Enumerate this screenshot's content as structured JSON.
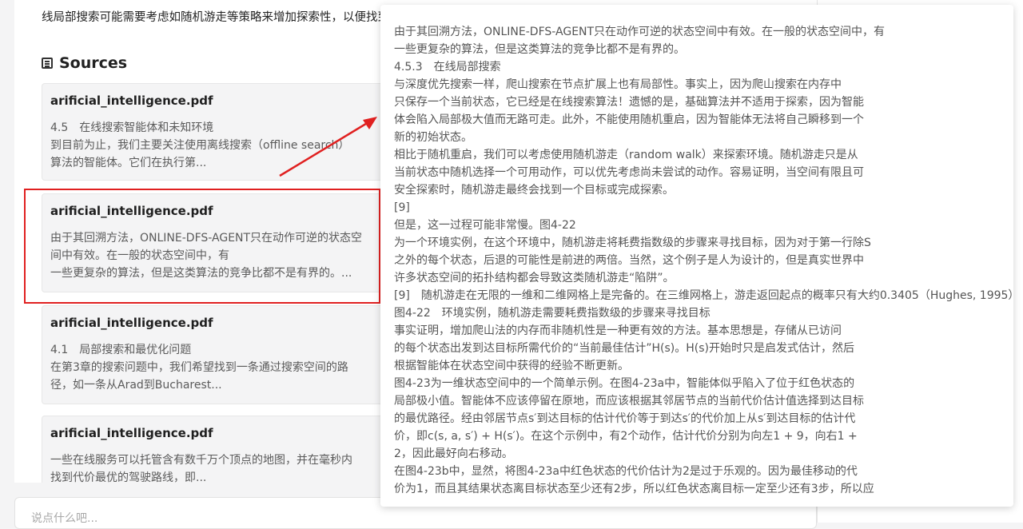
{
  "answer": {
    "partial_line": "线局部搜索可能需要考虑如随机游走等策略来增加探索性，以便找到更好的解。"
  },
  "sources": {
    "title": "Sources",
    "icon": "book-icon",
    "cards": [
      {
        "filename": "arificial_intelligence.pdf",
        "excerpt": "4.5　在线搜索智能体和未知环境\n到目前为止，我们主要关注使用离线搜索（offline search）\n算法的智能体。它们在执行第..."
      },
      {
        "filename": "arificial_intelligence.pdf",
        "excerpt": "由于其回溯方法，ONLINE-DFS-AGENT只在动作可逆的状态空\n间中有效。在一般的状态空间中，有\n一些更复杂的算法，但是这类算法的竞争比都不是有界的。..."
      },
      {
        "filename": "arificial_intelligence.pdf",
        "excerpt": "4.1　局部搜索和最优化问题\n在第3章的搜索问题中，我们希望找到一条通过搜索空间的路\n径，如一条从Arad到Bucharest..."
      },
      {
        "filename": "arificial_intelligence.pdf",
        "excerpt": "一些在线服务可以托管含有数千万个顶点的地图，并在毫秒内\n找到代价最优的驾驶路线，即..."
      }
    ]
  },
  "input": {
    "placeholder": "说点什么吧..."
  },
  "popover": {
    "lines": [
      "由于其回溯方法，ONLINE-DFS-AGENT只在动作可逆的状态空间中有效。在一般的状态空间中，有",
      "一些更复杂的算法，但是这类算法的竞争比都不是有界的。",
      "4.5.3　在线局部搜索",
      "与深度优先搜索一样，爬山搜索在节点扩展上也有局部性。事实上，因为爬山搜索在内存中",
      "只保存一个当前状态，它已经是在线搜索算法！遗憾的是，基础算法并不适用于探索，因为智能",
      "体会陷入局部极大值而无路可走。此外，不能使用随机重启，因为智能体无法将自己瞬移到一个",
      "新的初始状态。",
      "相比于随机重启，我们可以考虑使用随机游走（random walk）来探索环境。随机游走只是从",
      "当前状态中随机选择一个可用动作，可以优先考虑尚未尝试的动作。容易证明，当空间有限且可",
      "安全探索时，随机游走最终会找到一个目标或完成探索。",
      "[9]",
      "但是，这一过程可能非常慢。图4-22",
      "为一个环境实例，在这个环境中，随机游走将耗费指数级的步骤来寻找目标，因为对于第一行除S",
      "之外的每个状态，后退的可能性是前进的两倍。当然，这个例子是人为设计的，但是真实世界中",
      "许多状态空间的拓扑结构都会导致这类随机游走“陷阱”。",
      "[9]　随机游走在无限的一维和二维网格上是完备的。在三维网格上，游走返回起点的概率只有大约0.3405（Hughes, 1995）。",
      "图4-22　环境实例，随机游走需要耗费指数级的步骤来寻找目标",
      "事实证明，增加爬山法的内存而非随机性是一种更有效的方法。基本思想是，存储从已访问",
      "的每个状态出发到达目标所需代价的“当前最佳估计”H(s)。H(s)开始时只是启发式估计，然后",
      "根据智能体在状态空间中获得的经验不断更新。",
      "图4-23为一维状态空间中的一个简单示例。在图4-23a中，智能体似乎陷入了位于红色状态的",
      "局部极小值。智能体不应该停留在原地，而应该根据其邻居节点的当前代价估计值选择到达目标",
      "的最优路径。经由邻居节点s′到达目标的估计代价等于到达s′的代价加上从s′到达目标的估计代",
      "价，即c(s, a, s′) + H(s′)。在这个示例中，有2个动作，估计代价分别为向左1 + 9，向右1 +",
      "2，因此最好向右移动。",
      "在图4-23b中，显然，将图4-23a中红色状态的代价估计为2是过于乐观的。因为最佳移动的代",
      "价为1，而且其结果状态离目标状态至少还有2步，所以红色状态离目标一定至少还有3步，所以应"
    ]
  },
  "colors": {
    "highlight": "#e02020",
    "arrow": "#e02020"
  }
}
